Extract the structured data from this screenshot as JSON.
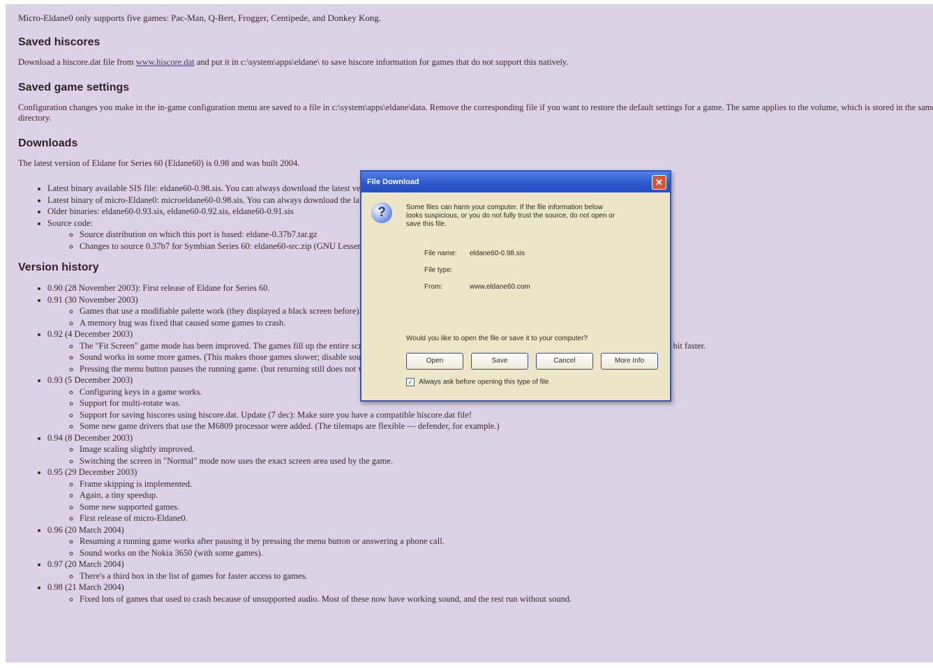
{
  "intro": "Micro-Eldane0 only supports five games: Pac-Man, Q-Bert, Frogger, Centipede, and Donkey Kong.",
  "sections": {
    "hiscores": {
      "heading": "Saved hiscores",
      "text_before": "Download a hiscore.dat file from",
      "link": "www.hiscore.dat",
      "text_after": "and put it in c:\\system\\apps\\eldane\\ to save hiscore information for games that do not support this natively."
    },
    "settings": {
      "heading": "Saved game settings",
      "text": "Configuration changes you make in the in-game configuration menu are saved to a file in c:\\system\\apps\\eldane\\data. Remove the corresponding file if you want to restore the default settings for a game. The same applies to the volume, which is stored in the same directory."
    },
    "downloads": {
      "heading": "Downloads",
      "intro": "The latest version of Eldane for Series 60 (Eldane60) is 0.98 and was built 2004.",
      "items": [
        "Latest binary available SIS file: eldane60-0.98.sis. You can always download the latest version to this site.",
        "Latest binary of micro-Eldane0: microeldane60-0.98.sis. You can always download the latest version to this site.",
        "Older binaries: eldane60-0.93.sis, eldane60-0.92.sis, eldane60-0.91.sis"
      ],
      "source": {
        "label": "Source code:",
        "subitems": [
          "Source distribution on which this port is based: eldane-0.37b7.tar.gz",
          "Changes to source 0.37b7 for Symbian Series 60: eldane60-src.zip (GNU Lesser General Public License (GPL))"
        ]
      }
    },
    "history": {
      "heading": "Version history",
      "versions": [
        {
          "label": "0.90 (28 November 2003): First release of Eldane for Series 60.",
          "notes": []
        },
        {
          "label": "0.91 (30 November 2003)",
          "notes": [
            "Games that use a modifiable palette work (they displayed a black screen before).",
            "A memory bug was fixed that caused some games to crash."
          ]
        },
        {
          "label": "0.92 (4 December 2003)",
          "notes": [
            "The \"Fit Screen\" game mode has been improved. The games fill up the entire screen (in size landscape), and the scaled games screens looks better. Also, scaling is a little bit faster.",
            "Sound works in some more games. (This makes those games slower; disable sound if this is a problem.)",
            "Pressing the menu button pauses the running game. (but returning still does not work.)"
          ]
        },
        {
          "label": "0.93 (5 December 2003)",
          "notes": [
            "Configuring keys in a game works.",
            "Support for multi-rotate was.",
            "Support for saving hiscores using hiscore.dat. Update (7 dec): Make sure you have a compatible hiscore.dat file!",
            "Some new game drivers that use the M6809 processor were added. (The tilemaps are flexible — defender, for example.)"
          ]
        },
        {
          "label": "0.94 (8 December 2003)",
          "notes": [
            "Image scaling slightly improved.",
            "Switching the screen in \"Normal\" mode now uses the exact screen area used by the game."
          ]
        },
        {
          "label": "0.95 (29 December 2003)",
          "notes": [
            "Frame skipping is implemented.",
            "Again, a tiny speedup.",
            "Some new supported games.",
            "First release of micro-Eldane0."
          ]
        },
        {
          "label": "0.96 (20 March 2004)",
          "notes": [
            "Resuming a running game works after pausing it by pressing the menu button or answering a phone call.",
            "Sound works on the Nokia 3650 (with some games)."
          ]
        },
        {
          "label": "0.97 (20 March 2004)",
          "notes": [
            "There's a third box in the list of games for faster access to games."
          ]
        },
        {
          "label": "0.98 (21 March 2004)",
          "notes": [
            "Fixed lots of games that used to crash because of unsupported audio. Most of these now have working sound, and the rest run without sound."
          ]
        }
      ]
    }
  },
  "dialog": {
    "title": "File Download",
    "close_glyph": "✕",
    "warning": "Some files can harm your computer. If the file information below looks suspicious, or you do not fully trust the source, do not open or save this file.",
    "fields": {
      "name_label": "File name:",
      "name_value": "eldane60-0.98.sis",
      "type_label": "File type:",
      "type_value": "",
      "from_label": "From:",
      "from_value": "www.eldane60.com"
    },
    "prompt": "Would you like to open the file or save it to your computer?",
    "buttons": {
      "open": "Open",
      "save": "Save",
      "cancel": "Cancel",
      "more_info": "More Info"
    },
    "always_ask": "Always ask before opening this type of file"
  },
  "colors": {
    "page_background": "#dcd2e6",
    "dialog_background": "#ede6c9",
    "titlebar": "#2a55c8",
    "close_button": "#d9553a"
  }
}
